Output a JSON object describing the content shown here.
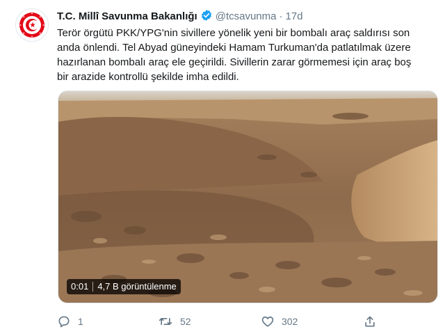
{
  "tweet": {
    "author_name": "T.C. Millî Savunma Bakanlığı",
    "handle": "@tcsavunma",
    "separator": "·",
    "time": "17d",
    "text_lines": [
      "Terör örgütü PKK/YPG'nin sivillere yönelik yeni bir bombalı araç saldırısı son",
      "anda önlendi. Tel Abyad güneyindeki Hamam Turkuman'da patlatılmak üzere",
      "hazırlanan bombalı araç ele geçirildi. Sivillerin zarar görmemesi için araç boş",
      "bir arazide kontrollü şekilde imha edildi."
    ]
  },
  "video": {
    "elapsed": "0:01",
    "views": "4,7 B görüntülenme"
  },
  "actions": {
    "reply_icon": "reply-icon",
    "reply_count": "1",
    "retweet_icon": "retweet-icon",
    "retweet_count": "52",
    "like_icon": "heart-icon",
    "like_count": "302",
    "share_icon": "share-icon"
  },
  "colors": {
    "logo_red": "#e30a17",
    "verified_blue": "#1da1f2",
    "secondary_text": "#657786"
  }
}
